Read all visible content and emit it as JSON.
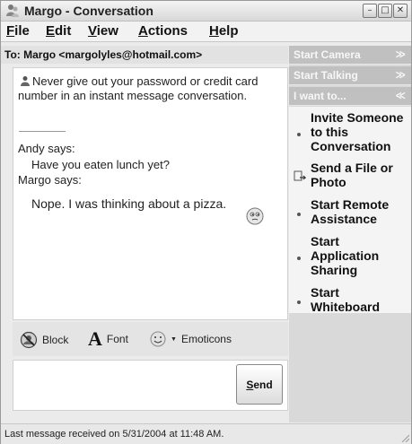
{
  "window": {
    "title": "Margo - Conversation",
    "buttons": {
      "minimize": "–",
      "restore": "□",
      "close": "✕"
    }
  },
  "menu": [
    {
      "label": "File",
      "underline": "F",
      "rest": "ile"
    },
    {
      "label": "Edit",
      "underline": "E",
      "rest": "dit"
    },
    {
      "label": "View",
      "underline": "V",
      "rest": "iew"
    },
    {
      "label": "Actions",
      "underline": "A",
      "rest": "ctions"
    },
    {
      "label": "Help",
      "underline": "H",
      "rest": "elp"
    }
  ],
  "to_line": "To:  Margo <margolyles@hotmail.com>",
  "conversation": {
    "warning": "Never give out your password or credit card number in an instant message conversation.",
    "messages": [
      {
        "speaker": "Andy says:",
        "text": "Have you eaten lunch yet?"
      },
      {
        "speaker": "Margo says:",
        "text": "Nope. I was thinking about a pizza."
      }
    ]
  },
  "toolbar": {
    "block": "Block",
    "font_glyph": "A",
    "font": "Font",
    "emoticons": "Emoticons"
  },
  "compose": {
    "send": "Send",
    "send_underline": "S",
    "send_rest": "end"
  },
  "status": "Last message received on 5/31/2004 at 11:48 AM.",
  "side_panel": {
    "sections": [
      {
        "label": "Start Camera",
        "chevron": "≫",
        "expanded": false
      },
      {
        "label": "Start Talking",
        "chevron": "≫",
        "expanded": false
      },
      {
        "label": "I want to...",
        "chevron": "≪",
        "expanded": true
      }
    ],
    "tasks": [
      {
        "line1": "Invite Someone",
        "line2": "to this",
        "line3": "Conversation"
      },
      {
        "line1": "Send a File or",
        "line2": "Photo"
      },
      {
        "line1": "Start Remote",
        "line2": "Assistance"
      },
      {
        "line1": "Start",
        "line2": "Application",
        "line3": "Sharing"
      },
      {
        "line1": "Start",
        "line2": "Whiteboard"
      }
    ]
  },
  "colors": {
    "pane_header": "#c0c0c0",
    "pane_body": "#f4f4f4",
    "window_bg": "#ebebeb"
  }
}
